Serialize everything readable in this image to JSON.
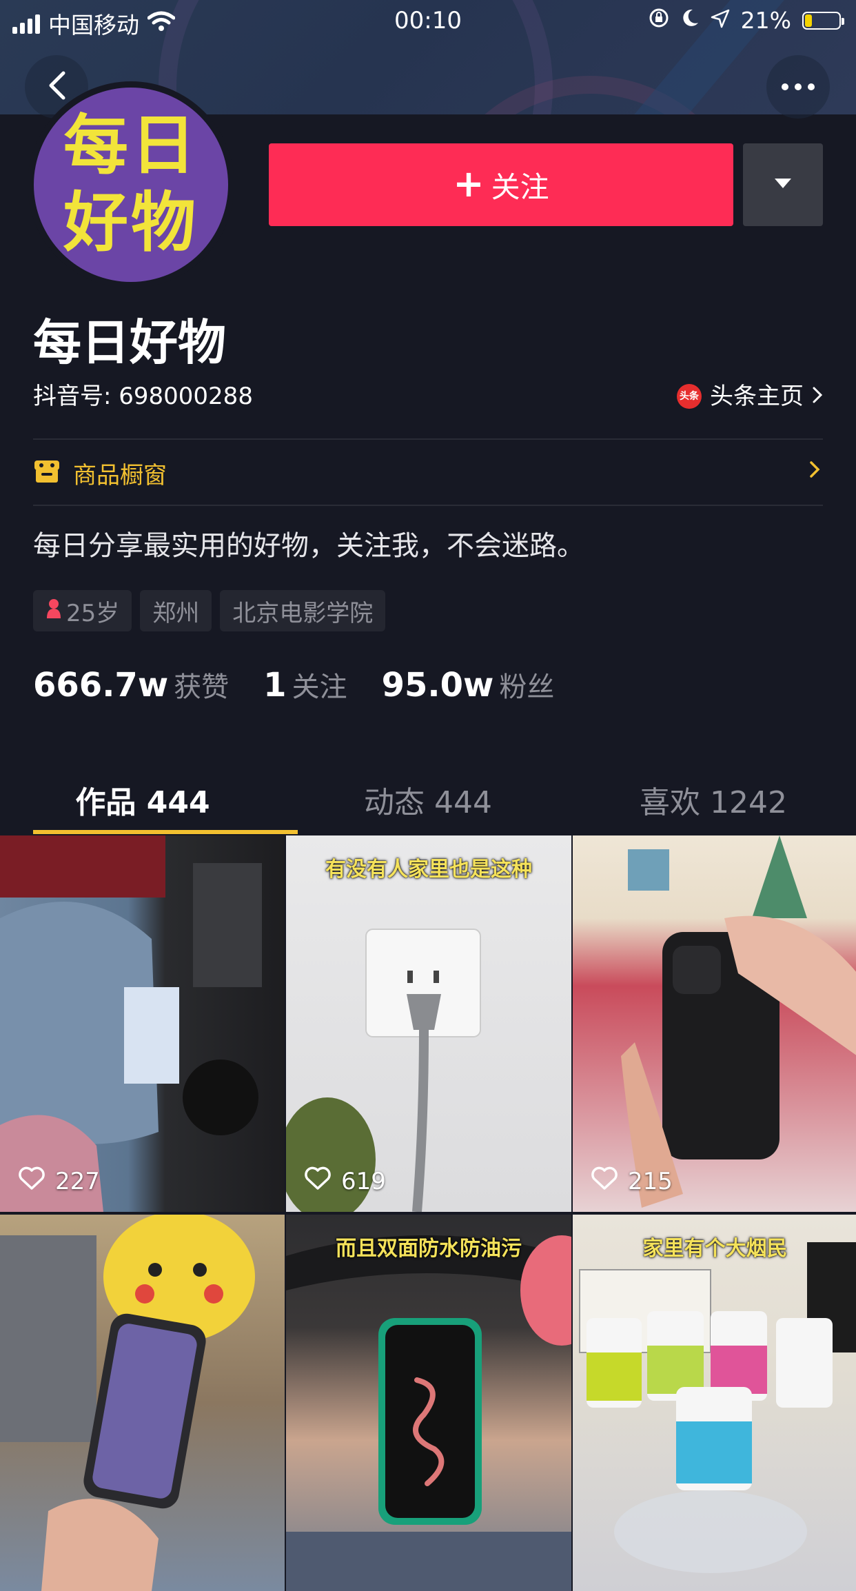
{
  "status_bar": {
    "carrier": "中国移动",
    "time": "00:10",
    "battery": "21%",
    "battery_level": 0.21,
    "icons": [
      "signal-icon",
      "wifi-icon",
      "orientation-lock-icon",
      "moon-icon",
      "location-icon",
      "battery-icon"
    ]
  },
  "header": {
    "back_icon": "back-chevron-icon",
    "more_icon": "more-dots-icon"
  },
  "profile": {
    "avatar_text_line1": "每日",
    "avatar_text_line2": "好物",
    "follow_label": "关注",
    "follow_plus": "+",
    "nickname": "每日好物",
    "douyin_id": "抖音号: 698000288",
    "toutiao_badge": "头条",
    "toutiao_label": "头条主页",
    "shop_label": "商品橱窗",
    "bio": "每日分享最实用的好物，关注我，不会迷路。",
    "tags": {
      "age": "25岁",
      "city": "郑州",
      "school": "北京电影学院"
    },
    "stats": {
      "likes_num": "666.7w",
      "likes_label": "获赞",
      "following_num": "1",
      "following_label": "关注",
      "followers_num": "95.0w",
      "followers_label": "粉丝"
    }
  },
  "tabs": [
    {
      "label": "作品 444",
      "active": true
    },
    {
      "label": "动态 444",
      "active": false
    },
    {
      "label": "喜欢 1242",
      "active": false
    }
  ],
  "colors": {
    "background": "#161823",
    "follow_button": "#fe2c55",
    "accent_yellow": "#f2c030",
    "avatar_purple": "#6b45a6"
  },
  "videos": [
    {
      "caption": "",
      "likes": "227"
    },
    {
      "caption": "有没有人家里也是这种",
      "likes": "619"
    },
    {
      "caption": "",
      "likes": "215"
    },
    {
      "caption": "",
      "likes": ""
    },
    {
      "caption": "而且双面防水防油污",
      "likes": ""
    },
    {
      "caption": "家里有个大烟民",
      "likes": ""
    }
  ]
}
